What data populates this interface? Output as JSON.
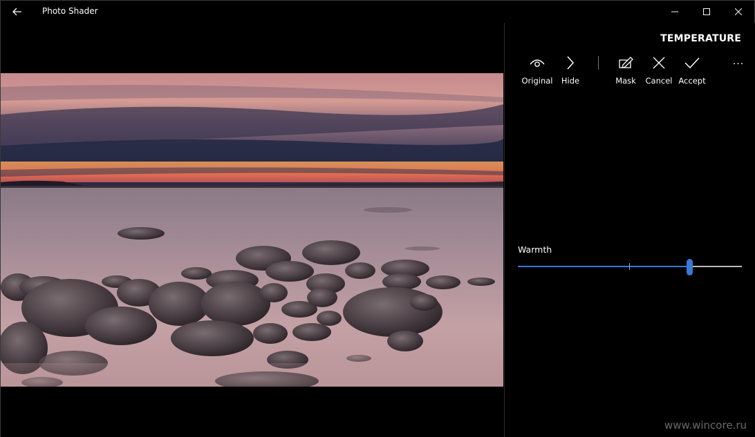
{
  "titlebar": {
    "app_title": "Photo Shader",
    "back_icon": "back-arrow-icon",
    "minimize_icon": "minimize-icon",
    "maximize_icon": "maximize-icon",
    "close_icon": "close-icon"
  },
  "panel": {
    "title": "TEMPERATURE",
    "tools": [
      {
        "label": "Original",
        "icon": "eye-icon"
      },
      {
        "label": "Hide",
        "icon": "chevron-right-icon"
      },
      {
        "label": "Mask",
        "icon": "pencil-box-icon"
      },
      {
        "label": "Cancel",
        "icon": "x-icon"
      },
      {
        "label": "Accept",
        "icon": "check-icon"
      }
    ],
    "more_label": "···",
    "slider": {
      "label": "Warmth",
      "value_fraction": 0.765,
      "accent": "#3a78d6"
    }
  },
  "watermark": "www.wincore.ru"
}
